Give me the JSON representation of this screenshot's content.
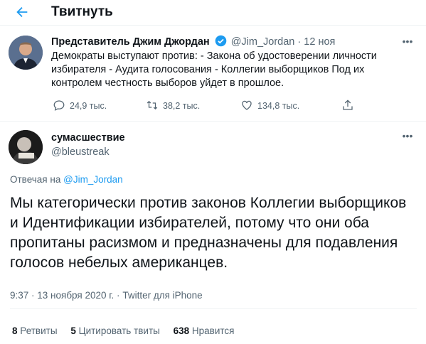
{
  "header": {
    "title": "Твитнуть",
    "back_icon": "arrow-left-icon"
  },
  "original_tweet": {
    "name": "Представитель Джим Джордан",
    "handle": "@Jim_Jordan",
    "separator": "·",
    "date": "12 ноя",
    "text": "Демократы выступают против: - Закона об удостоверении личности избирателя - Аудита голосования - Коллегии выборщиков Под их контролем честность выборов уйдет в прошлое.",
    "replies": "24,9 тыс.",
    "retweets": "38,2 тыс.",
    "likes": "134,8 тыс."
  },
  "reply_tweet": {
    "name": "сумасшествие",
    "handle": "@bleustreak",
    "replying_label": "Отвечая на",
    "replying_handle": "@Jim_Jordan",
    "text": "Мы категорически против законов Коллегии выборщиков и Идентификации избирателей, потому что они оба пропитаны расизмом и предназначены для подавления голосов небелых американцев.",
    "time": "9:37 · 13 ноября 2020 г.",
    "separator": "·",
    "source": "Twitter для iPhone",
    "stats": {
      "retweets_count": "8",
      "retweets_label": "Ретвиты",
      "quotes_count": "5",
      "quotes_label": "Цитировать твиты",
      "likes_count": "638",
      "likes_label": "Нравится"
    }
  },
  "colors": {
    "accent": "#1d9bf0",
    "muted": "#536471",
    "text": "#0f1419"
  }
}
